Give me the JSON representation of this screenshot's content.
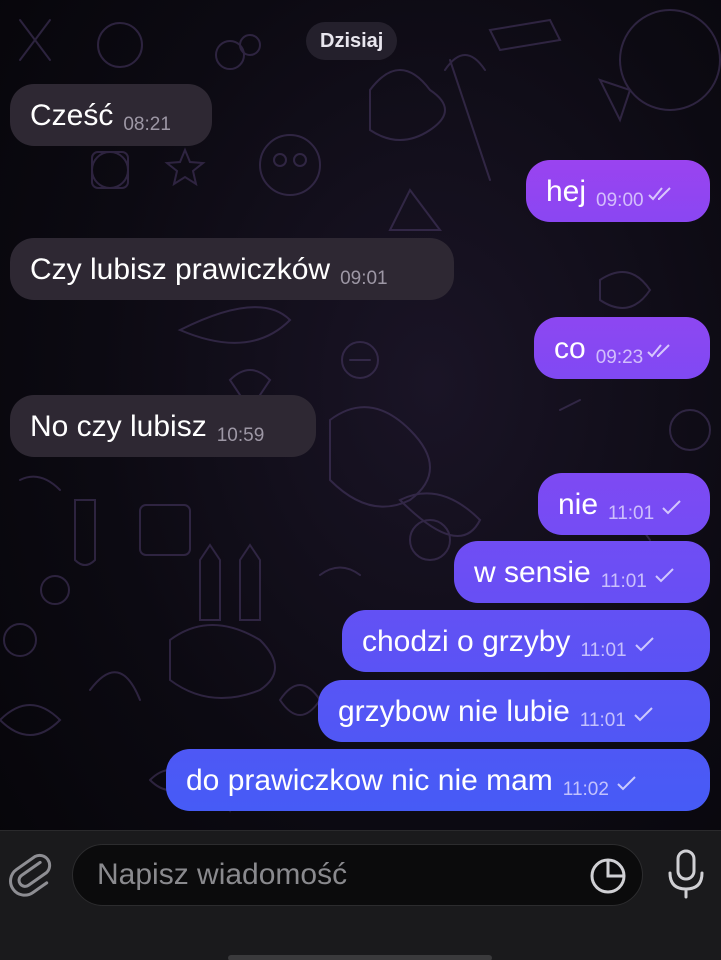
{
  "chat": {
    "date_separator": "Dzisiaj",
    "messages": [
      {
        "direction": "incoming",
        "text": "Cześć",
        "time": "08:21"
      },
      {
        "direction": "outgoing",
        "text": "hej",
        "time": "09:00",
        "status": "read"
      },
      {
        "direction": "incoming",
        "text": "Czy lubisz prawiczków",
        "time": "09:01"
      },
      {
        "direction": "outgoing",
        "text": "co",
        "time": "09:23",
        "status": "read"
      },
      {
        "direction": "incoming",
        "text": "No czy lubisz",
        "time": "10:59"
      },
      {
        "direction": "outgoing",
        "text": "nie",
        "time": "11:01",
        "status": "sent"
      },
      {
        "direction": "outgoing",
        "text": "w sensie",
        "time": "11:01",
        "status": "sent"
      },
      {
        "direction": "outgoing",
        "text": "chodzi o grzyby",
        "time": "11:01",
        "status": "sent"
      },
      {
        "direction": "outgoing",
        "text": "grzybow nie lubie",
        "time": "11:01",
        "status": "sent"
      },
      {
        "direction": "outgoing",
        "text": "do prawiczkow nic nie mam",
        "time": "11:02",
        "status": "sent"
      }
    ]
  },
  "composer": {
    "placeholder": "Napisz wiadomość",
    "attach_icon": "paperclip-icon",
    "sticker_icon": "sticker-icon",
    "mic_icon": "microphone-icon"
  },
  "colors": {
    "incoming_bubble": "#2e2833",
    "outgoing_gradient_top": "#9b45f0",
    "outgoing_gradient_bottom": "#4a5cf5",
    "background": "#0c0a12"
  }
}
